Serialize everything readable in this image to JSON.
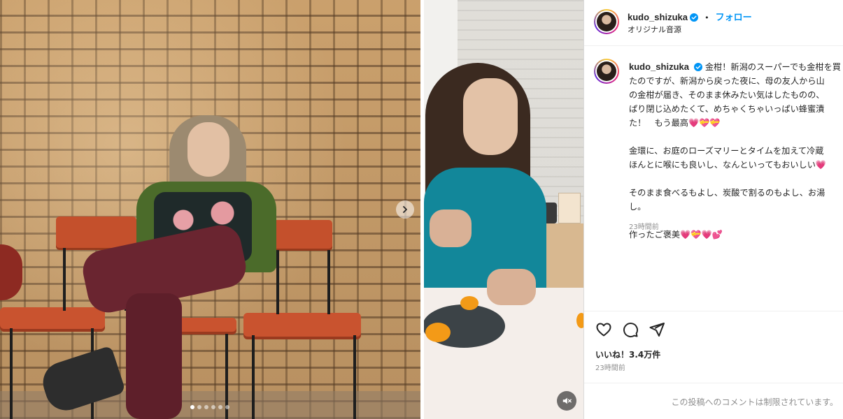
{
  "photo_carousel": {
    "next_icon": "chevron-right-icon",
    "dots_total": 6,
    "active_dot": 1
  },
  "video": {
    "mute_icon": "speaker-muted-icon"
  },
  "post": {
    "header": {
      "username": "kudo_shizuka",
      "separator": "•",
      "follow_label": "フォロー",
      "audio_label": "オリジナル音源"
    },
    "caption": {
      "username": "kudo_shizuka",
      "body": "金柑！新潟のスーパーでも金柑を買\nたのですが、新潟から戻った夜に、母の友人から山\nの金柑が届き、そのまま休みたい気はしたものの、\nぱり閉じ込めたくて、めちゃくちゃいっぱい蜂蜜漬\nた！　もう最高💗💝💝\n\n金環に、お庭のローズマリーとタイムを加えて冷蔵\nほんとに喉にも良いし、なんといってもおいしい💗\n\nそのまま食べるもよし、炭酸で割るのもよし、お湯\nし。\n\n作ったご褒美💗💝💗💕",
      "time": "23時間前"
    },
    "actions": {
      "like_icon": "heart-icon",
      "comment_icon": "comment-icon",
      "share_icon": "send-icon"
    },
    "likes": "いいね！3.4万件",
    "date": "23時間前",
    "comments_disabled": "この投稿へのコメントは制限されています。"
  },
  "colors": {
    "accent": "#0095f6",
    "text": "#262626",
    "muted": "#8e8e8e",
    "verified": "#0095f6"
  }
}
